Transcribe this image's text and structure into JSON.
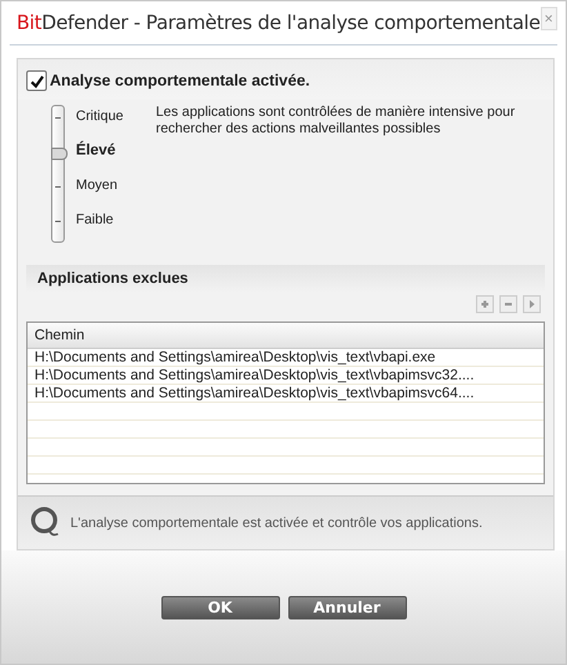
{
  "window": {
    "title_accent": "Bit",
    "title": "Defender - Paramètres de l'analyse comportementale",
    "close": "×"
  },
  "enable": {
    "label": "Analyse comportementale activée.",
    "checked": true
  },
  "levels": [
    {
      "label": "Critique",
      "selected": false
    },
    {
      "label": "Élevé",
      "selected": true
    },
    {
      "label": "Moyen",
      "selected": false
    },
    {
      "label": "Faible",
      "selected": false
    }
  ],
  "level_description": "Les applications sont contrôlées de manière intensive pour rechercher des actions malveillantes possibles",
  "excluded": {
    "title": "Applications exclues",
    "columns": [
      "Chemin"
    ],
    "rows": [
      [
        "H:\\Documents and Settings\\amirea\\Desktop\\vis_text\\vbapi.exe"
      ],
      [
        "H:\\Documents and Settings\\amirea\\Desktop\\vis_text\\vbapimsvc32...."
      ],
      [
        "H:\\Documents and Settings\\amirea\\Desktop\\vis_text\\vbapimsvc64...."
      ]
    ]
  },
  "status": "L'analyse comportementale est activée et contrôle vos applications.",
  "buttons": [
    "OK",
    "Annuler"
  ]
}
